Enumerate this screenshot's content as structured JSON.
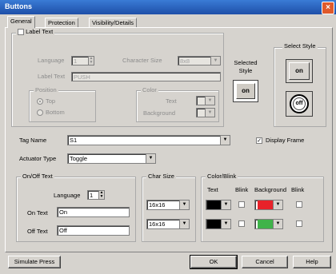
{
  "window": {
    "title": "Buttons",
    "close": "×"
  },
  "tabs": [
    "General",
    "Protection",
    "Visibility/Details"
  ],
  "label_text_section": {
    "title": "Label Text",
    "language_label": "Language",
    "language_value": "1",
    "character_size_label": "Character Size",
    "character_size_value": "8x8",
    "label_text_label": "Label Text",
    "label_text_value": "PUSH"
  },
  "position": {
    "title": "Position",
    "top": "Top",
    "bottom": "Bottom"
  },
  "color": {
    "title": "Color",
    "text_label": "Text",
    "background_label": "Background"
  },
  "selected_style": {
    "label_line1": "Selected",
    "label_line2": "Style",
    "preview": "on"
  },
  "select_style": {
    "title": "Select Style",
    "option1": "on",
    "option2": "off"
  },
  "tag_name": {
    "label": "Tag Name",
    "value": "S1"
  },
  "display_frame": {
    "label": "Display Frame",
    "checked": "✓"
  },
  "actuator_type": {
    "label": "Actuator Type",
    "value": "Toggle"
  },
  "on_off_text": {
    "title": "On/Off Text",
    "language_label": "Language",
    "language_value": "1",
    "on_label": "On Text",
    "on_value": "On",
    "off_label": "Off Text",
    "off_value": "Off"
  },
  "char_size": {
    "title": "Char Size",
    "row1": "16x16",
    "row2": "16x16"
  },
  "color_blink": {
    "title": "Color/Blink",
    "text_header": "Text",
    "blink_header": "Blink",
    "background_header": "Background",
    "blink2_header": "Blink",
    "row1_text_color": "#000000",
    "row1_bg_color": "#e8222a",
    "row2_text_color": "#000000",
    "row2_bg_color": "#3fb34a"
  },
  "buttons": {
    "simulate": "Simulate Press",
    "ok": "OK",
    "cancel": "Cancel",
    "help": "Help"
  },
  "icons": {
    "dropdown": "▼",
    "spin_up": "▲",
    "spin_down": "▼"
  }
}
